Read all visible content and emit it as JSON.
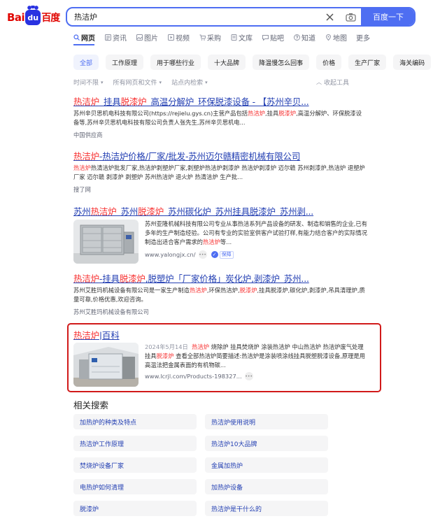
{
  "logo": {
    "part1": "Bai",
    "paw": "du",
    "part2": "百度"
  },
  "search": {
    "query": "热洁炉",
    "button": "百度一下"
  },
  "tabs": [
    {
      "label": "网页",
      "icon": "search-icon"
    },
    {
      "label": "资讯",
      "icon": "news-icon"
    },
    {
      "label": "图片",
      "icon": "image-icon"
    },
    {
      "label": "视频",
      "icon": "video-icon"
    },
    {
      "label": "采购",
      "icon": "cart-icon"
    },
    {
      "label": "文库",
      "icon": "doc-icon"
    },
    {
      "label": "贴吧",
      "icon": "forum-icon"
    },
    {
      "label": "知道",
      "icon": "question-icon"
    },
    {
      "label": "地图",
      "icon": "map-pin-icon"
    },
    {
      "label": "更多",
      "icon": ""
    }
  ],
  "chips": [
    "全部",
    "工作原理",
    "用于哪些行业",
    "十大品牌",
    "降温慢怎么回事",
    "价格",
    "生产厂家",
    "海关编码"
  ],
  "tools": {
    "time": "时间不限",
    "scope": "所有网页和文件",
    "site": "站点内检索",
    "collapse": "收起工具"
  },
  "results": [
    {
      "title_parts": [
        [
          "热洁炉",
          true
        ],
        [
          "_挂具",
          false
        ],
        [
          "脱漆炉",
          true
        ],
        [
          "_高温分解炉_环保脱漆设备 - 【苏州辛贝...",
          false
        ]
      ],
      "abstract_parts": [
        [
          "苏州辛贝思机电科技有限公司(https://rejielu.gys.cn)主营产品包括",
          false
        ],
        [
          "热洁炉",
          true
        ],
        [
          ",挂具",
          false
        ],
        [
          "脱漆炉",
          true
        ],
        [
          ",高温分解炉、环保脱漆设备等,苏州辛贝思机电科技有限公司负责人张先生,苏州辛贝思机电...",
          false
        ]
      ],
      "source": "中国供应商"
    },
    {
      "title_parts": [
        [
          "热洁炉",
          true
        ],
        [
          "-热洁炉价格/厂家/批发-苏州迈尔赣精密机械有限公司",
          false
        ]
      ],
      "abstract_parts": [
        [
          "热洁炉",
          true
        ],
        [
          "热清洁炉批发厂家,热洁炉剥塑炉厂家,剥塑炉热洁炉剥漆炉 热洁炉剥漆炉 迈尔赣 苏州剥漆炉,热洁炉 退塑炉厂家 迈尔赣 剥漆炉 剥塑炉 苏州热洁炉 退火炉 热清洁炉 生产批...",
          false
        ]
      ],
      "source": "搜了网"
    },
    {
      "title_parts": [
        [
          "苏州",
          false
        ],
        [
          "热洁炉",
          true
        ],
        [
          "_苏州",
          false
        ],
        [
          "脱漆炉",
          true
        ],
        [
          "_苏州碳化炉_苏州挂具脱漆炉_苏州剥...",
          false
        ]
      ],
      "abstract_parts": [
        [
          "苏州亚隆机械科技有限公司专业从事热洁系列产品设备的研发、制造和销售的企业,已有多年的生产制造经验。公司有专业的实验室供客户试验打样,有能力结合客户的实际情况制造出适合客户需求的",
          false
        ],
        [
          "热洁炉",
          true
        ],
        [
          "等...",
          false
        ]
      ],
      "source": "www.yalongjx.cn/",
      "badge": "保障"
    },
    {
      "title_parts": [
        [
          "热洁炉",
          true
        ],
        [
          "-挂具",
          false
        ],
        [
          "脱漆炉",
          true
        ],
        [
          ",脱塑炉「厂家价格」炭化炉,剥漆炉_苏州...",
          false
        ]
      ],
      "abstract_parts": [
        [
          "苏州艾胜玛机械设备有限公司是一家生产制造",
          false
        ],
        [
          "热洁炉",
          true
        ],
        [
          ",环保热洁炉,",
          false
        ],
        [
          "脱漆炉",
          true
        ],
        [
          ",挂具脱漆炉,碳化炉,剥漆炉,吊具清理炉,质量可靠,价格优惠,欢迎咨询。",
          false
        ]
      ],
      "source": "苏州艾胜玛机械设备有限公司"
    },
    {
      "title_parts": [
        [
          "热洁炉",
          true
        ],
        [
          "|百科",
          false
        ]
      ],
      "date": "2024年5月14日",
      "abstract_parts": [
        [
          "热洁炉",
          true
        ],
        [
          " 烧除炉 挂具焚烧炉 涂装热洁炉 中山热洁炉 热洁炉废气处理 挂具",
          false
        ],
        [
          "脱漆炉",
          true
        ],
        [
          " 查看全部热洁炉简要描述:热洁炉是涂装喷涂线挂具脱塑脱漆设备,原理是用高温法把金属表面的有机物碳...",
          false
        ]
      ],
      "source": "www.lcrjl.com/Products-198327..."
    }
  ],
  "related": {
    "title": "相关搜索",
    "items": [
      "加热炉的种类及特点",
      "热洁炉使用说明",
      "热洁炉工作原理",
      "热洁炉10大品牌",
      "焚烧炉设备厂家",
      "金属加热炉",
      "电热炉如何清理",
      "加热炉设备",
      "脱漆炉",
      "热洁炉是干什么的"
    ]
  }
}
